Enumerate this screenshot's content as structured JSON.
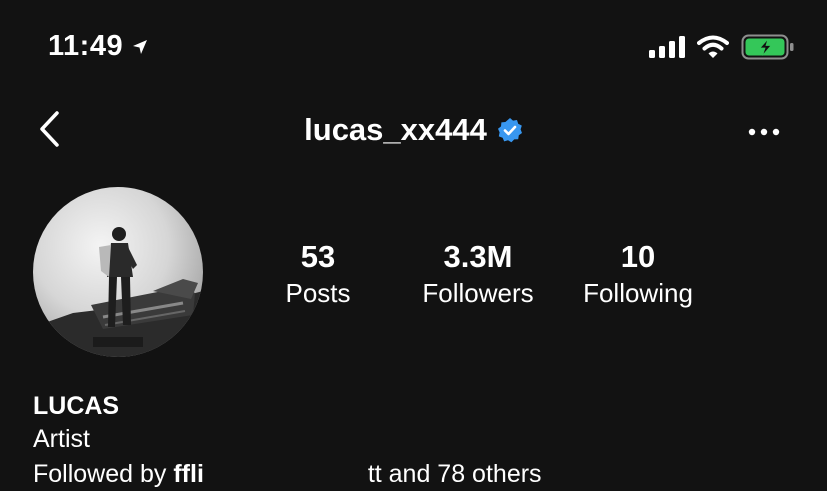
{
  "status_bar": {
    "time": "11:49",
    "icons": [
      "location-arrow-icon",
      "cellular-signal-icon",
      "wifi-icon",
      "battery-charging-icon"
    ],
    "battery_color": "#34c759"
  },
  "header": {
    "back_icon": "chevron-left-icon",
    "username": "lucas_xx444",
    "verified_icon": "verified-badge-icon",
    "verified_color": "#3897f0",
    "more_icon": "more-horizontal-icon"
  },
  "profile": {
    "avatar_icon": "profile-photo",
    "stats": [
      {
        "count": "53",
        "label": "Posts"
      },
      {
        "count": "3.3M",
        "label": "Followers"
      },
      {
        "count": "10",
        "label": "Following"
      }
    ]
  },
  "bio": {
    "name": "LUCAS",
    "category": "Artist",
    "followed_by_prefix": "Followed by",
    "followed_by_user_1": "ffli",
    "followed_by_user_2": "",
    "followed_by_more": "tt and 78 others"
  }
}
